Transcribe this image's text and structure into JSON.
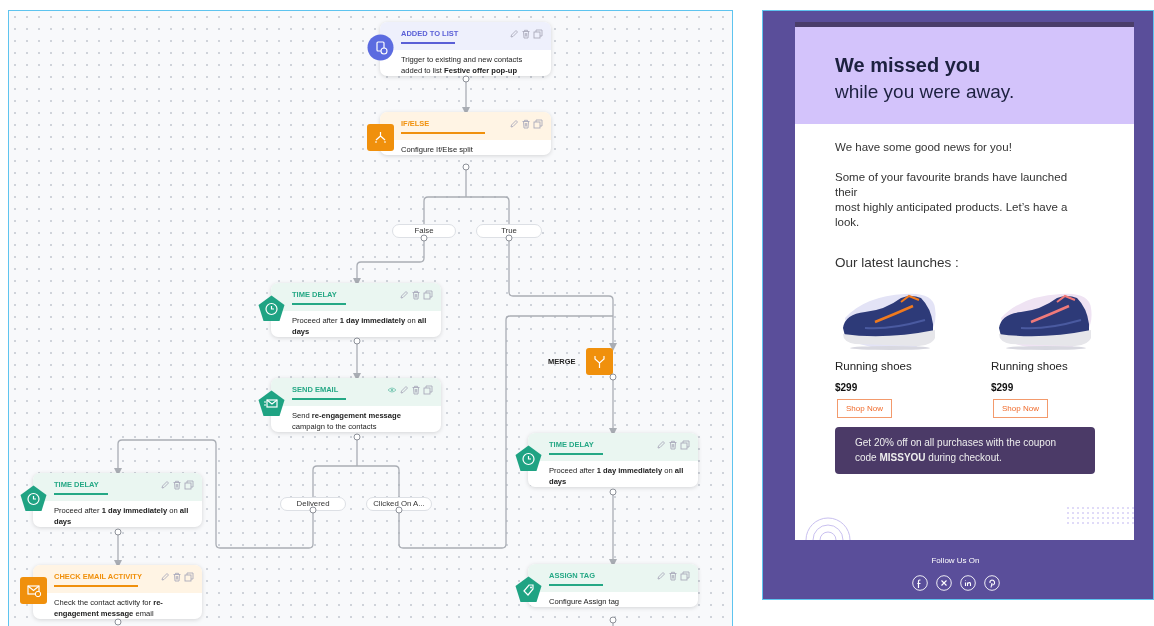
{
  "workflow": {
    "nodes": [
      {
        "kind": "trigger",
        "title": "ADDED TO LIST",
        "description": "Trigger to existing and new contacts added to list **Festive offer pop-up**"
      },
      {
        "kind": "condition",
        "title": "IF/ELSE",
        "description": "Configure If/Else split"
      },
      {
        "kind": "delay",
        "title": "TIME DELAY",
        "description": "Proceed after **1 day immediately** on **all days**"
      },
      {
        "kind": "email",
        "title": "SEND EMAIL",
        "description": "Send **re-engagement message** campaign to the contacts"
      },
      {
        "kind": "delay",
        "title": "TIME DELAY",
        "description": "Proceed after **1 day immediately** on **all days**"
      },
      {
        "kind": "activity",
        "title": "CHECK EMAIL ACTIVITY",
        "description": "Check the contact activity for **re-engagement message** email"
      },
      {
        "kind": "merge",
        "title": "MERGE"
      },
      {
        "kind": "delay",
        "title": "TIME DELAY",
        "description": "Proceed after **1 day immediately** on **all days**"
      },
      {
        "kind": "tag",
        "title": "ASSIGN TAG",
        "description": "Configure Assign tag"
      }
    ],
    "branch_labels": [
      "False",
      "True",
      "Delivered",
      "Clicked On A..."
    ]
  },
  "email_preview": {
    "heading": "We missed you",
    "subheading": "while you were away.",
    "intro": "We have some good news for you!",
    "paragraph_lines": [
      "Some of your favourite brands have launched their",
      "most highly anticipated products. Let’s have a look."
    ],
    "section_title": "Our latest launches :",
    "products": [
      {
        "kind": "picture",
        "name": "Running shoes",
        "price": "$299",
        "button": "Shop Now"
      },
      {
        "kind": "picture",
        "name": "Running shoes",
        "price": "$299",
        "button": "Shop Now"
      }
    ],
    "coupon": "Get 20% off on all purchases with the coupon code **MISSYOU** during checkout.",
    "footer": {
      "follow_label": "Follow Us On"
    }
  }
}
